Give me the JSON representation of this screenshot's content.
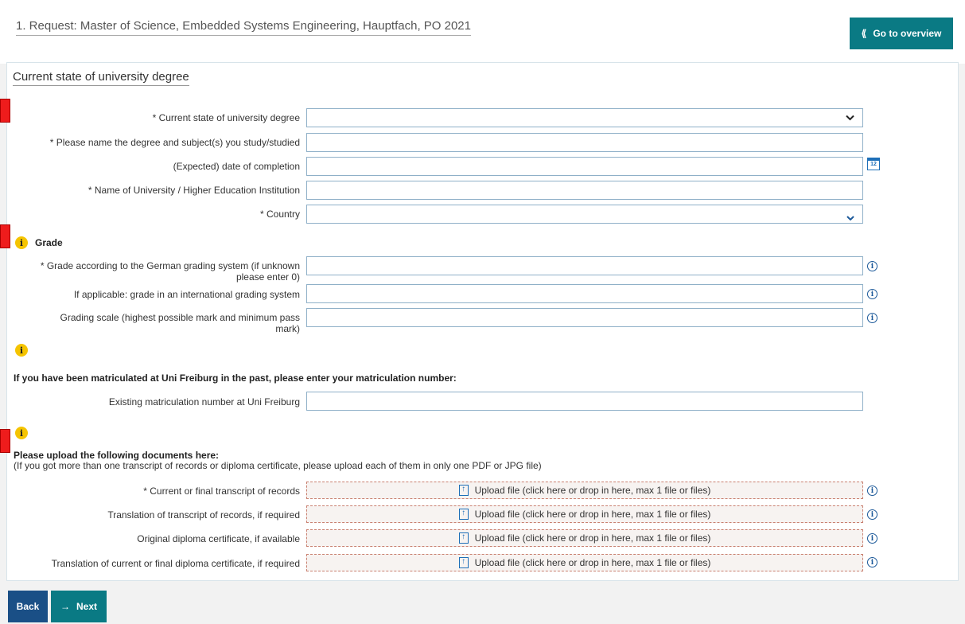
{
  "header": {
    "request_title": "1. Request: Master of Science, Embedded Systems Engineering, Hauptfach, PO 2021",
    "overview_button": "Go to overview",
    "overview_icon": "double-chevron-left-icon"
  },
  "section": {
    "title": "Current state of university degree"
  },
  "degree_fields": {
    "current_state_label": "* Current state of university degree",
    "current_state_value": "",
    "degree_subject_label": "* Please name the degree and subject(s) you study/studied",
    "completion_date_label": "(Expected) date of completion",
    "calendar_day": "12",
    "university_label": "* Name of University / Higher Education Institution",
    "country_label": "* Country",
    "country_value": ""
  },
  "grade": {
    "heading": "Grade",
    "german_grade_label": "* Grade according to the German grading system (if unknown please enter 0)",
    "international_grade_label": "If applicable: grade in an international grading system",
    "grading_scale_label": "Grading scale (highest possible mark and minimum pass mark)"
  },
  "matriculation": {
    "instruction": "If you have been matriculated at Uni Freiburg in the past, please enter your matriculation number:",
    "number_label": "Existing matriculation number at Uni Freiburg"
  },
  "documents": {
    "heading": "Please upload the following documents here:",
    "subtext": "(If you got more than one transcript of records or diploma certificate, please upload each of them in only one PDF or JPG file)",
    "upload_text": "Upload file (click here or drop in here, max 1 file or files)",
    "items": [
      {
        "label": "* Current or final transcript of records"
      },
      {
        "label": "Translation of transcript of records, if required"
      },
      {
        "label": "Original diploma certificate, if available"
      },
      {
        "label": "Translation of current or final diploma certificate, if required"
      }
    ]
  },
  "footer": {
    "back_button": "Back",
    "next_button": "Next"
  },
  "colors": {
    "teal_button": "#0a7a84",
    "navy_button": "#1a4f86",
    "info_yellow": "#f5c400",
    "marker_red": "#ee1c1c",
    "upload_border": "#c98070"
  }
}
